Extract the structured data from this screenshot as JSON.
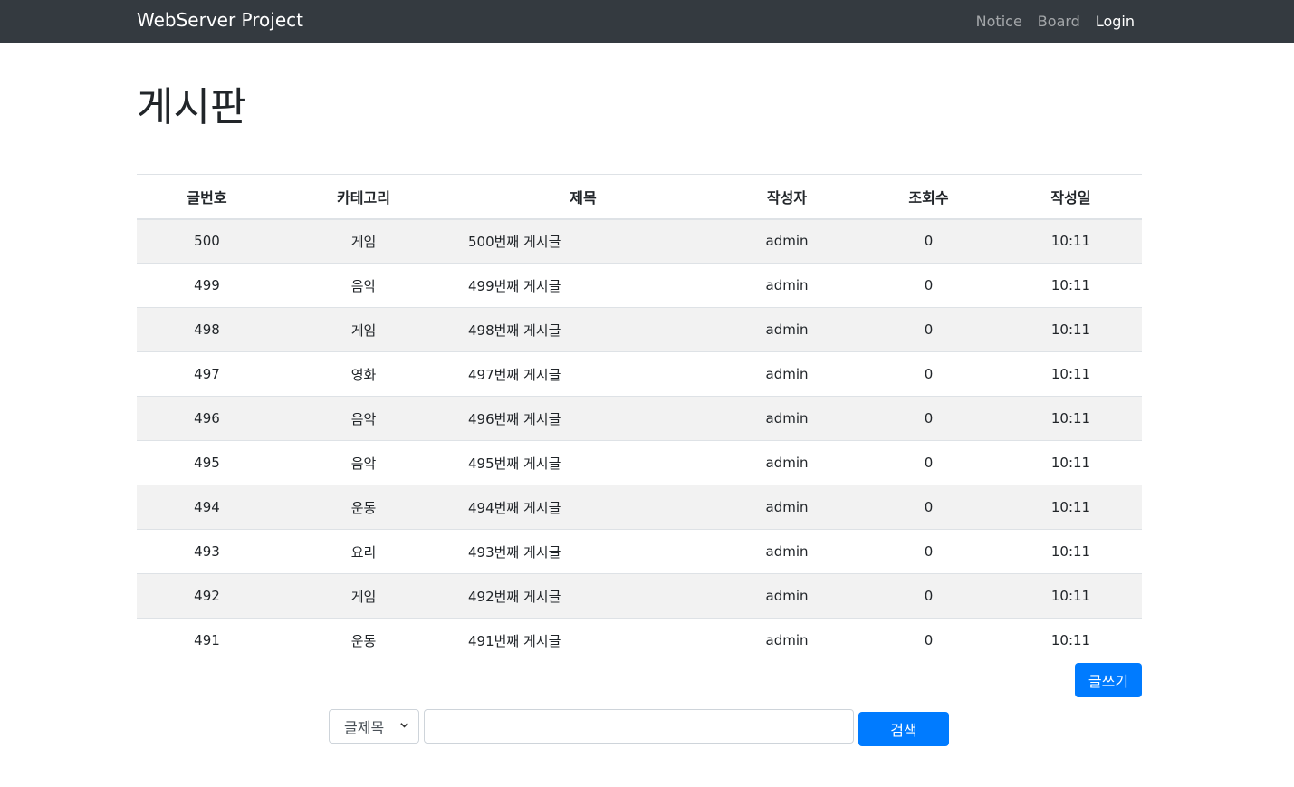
{
  "navbar": {
    "brand": "WebServer Project",
    "links": [
      {
        "label": "Notice"
      },
      {
        "label": "Board"
      },
      {
        "label": "Login"
      }
    ]
  },
  "page_title": "게시판",
  "table": {
    "headers": [
      "글번호",
      "카테고리",
      "제목",
      "작성자",
      "조회수",
      "작성일"
    ],
    "rows": [
      [
        "500",
        "게임",
        "500번째 게시글",
        "admin",
        "0",
        "10:11"
      ],
      [
        "499",
        "음악",
        "499번째 게시글",
        "admin",
        "0",
        "10:11"
      ],
      [
        "498",
        "게임",
        "498번째 게시글",
        "admin",
        "0",
        "10:11"
      ],
      [
        "497",
        "영화",
        "497번째 게시글",
        "admin",
        "0",
        "10:11"
      ],
      [
        "496",
        "음악",
        "496번째 게시글",
        "admin",
        "0",
        "10:11"
      ],
      [
        "495",
        "음악",
        "495번째 게시글",
        "admin",
        "0",
        "10:11"
      ],
      [
        "494",
        "운동",
        "494번째 게시글",
        "admin",
        "0",
        "10:11"
      ],
      [
        "493",
        "요리",
        "493번째 게시글",
        "admin",
        "0",
        "10:11"
      ],
      [
        "492",
        "게임",
        "492번째 게시글",
        "admin",
        "0",
        "10:11"
      ],
      [
        "491",
        "운동",
        "491번째 게시글",
        "admin",
        "0",
        "10:11"
      ]
    ]
  },
  "write_button": "글쓰기",
  "search": {
    "type_selected": "글제목",
    "query": "",
    "button": "검색"
  },
  "colors": {
    "navbar": "#343a40",
    "primary": "#007bff",
    "stripe": "#f2f2f2"
  }
}
